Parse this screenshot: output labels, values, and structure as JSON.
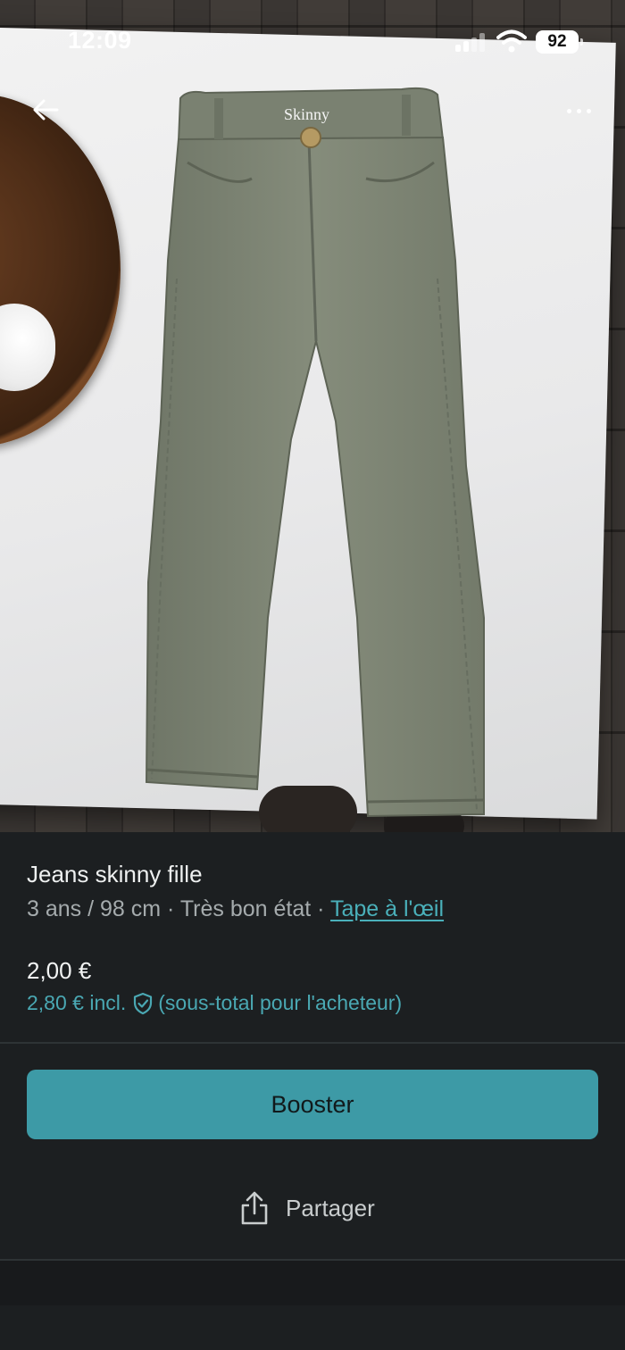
{
  "status_bar": {
    "time": "12:09",
    "battery": "92"
  },
  "nav": {
    "back_icon": "arrow-left-icon",
    "more_icon": "more-horizontal-icon"
  },
  "photo": {
    "description_icon": "product-photo",
    "label_on_item": "Skinny"
  },
  "listing": {
    "title": "Jeans skinny fille",
    "size": "3 ans / 98 cm",
    "separator": " · ",
    "condition": "Très bon état",
    "brand": "Tape à l'œil",
    "price": "2,00 €",
    "price_incl": "2,80 € incl.",
    "price_incl_note": "(sous-total pour l'acheteur)"
  },
  "actions": {
    "booster_label": "Booster",
    "share_label": "Partager"
  },
  "colors": {
    "accent": "#3d9aa6",
    "link": "#4ab0ba",
    "background": "#1c1f21"
  }
}
